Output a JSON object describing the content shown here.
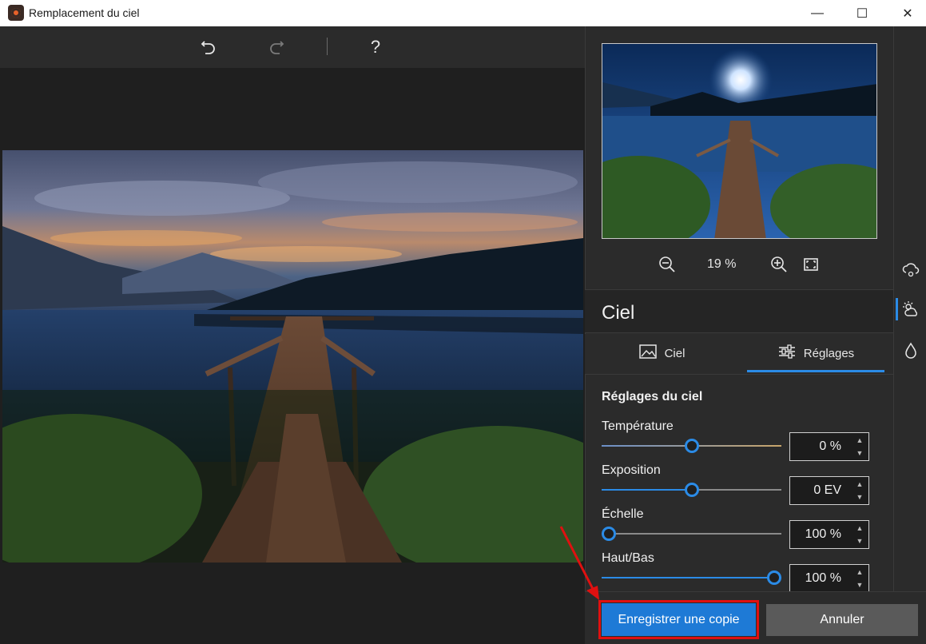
{
  "window": {
    "title": "Remplacement du ciel",
    "minimize": "—",
    "maximize": "☐",
    "close": "✕"
  },
  "toolbar": {
    "undo_icon": "undo-icon",
    "redo_icon": "redo-icon",
    "help_label": "?"
  },
  "preview": {
    "zoom_percent": "19 %"
  },
  "panel": {
    "title": "Ciel",
    "tabs": [
      {
        "label": "Ciel",
        "icon": "image-icon",
        "active": false
      },
      {
        "label": "Réglages",
        "icon": "sliders-icon",
        "active": true
      }
    ],
    "settings_title": "Réglages du ciel",
    "sliders": [
      {
        "label": "Température",
        "value": "0 %",
        "level": 0.5
      },
      {
        "label": "Exposition",
        "value": "0 EV",
        "level": 0.5
      },
      {
        "label": "Échelle",
        "value": "100 %",
        "level": 0.0
      },
      {
        "label": "Haut/Bas",
        "value": "100 %",
        "level": 1.0
      }
    ]
  },
  "side_icons": [
    "cloud-gear-icon",
    "sun-cloud-icon",
    "drop-icon"
  ],
  "buttons": {
    "save_copy": "Enregistrer une copie",
    "cancel": "Annuler"
  },
  "colors": {
    "accent": "#2b8be6",
    "primary_button": "#1e7ad6",
    "highlight": "#e01010"
  }
}
